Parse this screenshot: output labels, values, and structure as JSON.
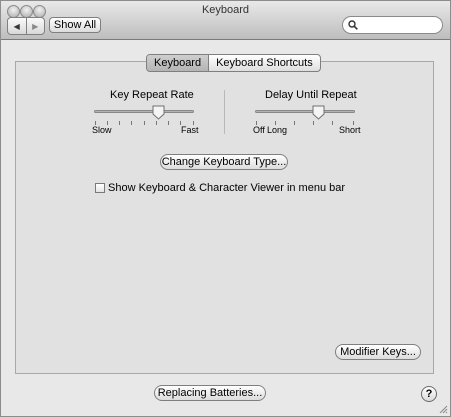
{
  "window": {
    "title": "Keyboard"
  },
  "toolbar": {
    "back_icon": "back-arrow-icon",
    "forward_icon": "forward-arrow-icon",
    "show_all_label": "Show All",
    "search": {
      "value": "",
      "placeholder": ""
    }
  },
  "tabs": [
    {
      "label": "Keyboard",
      "selected": true
    },
    {
      "label": "Keyboard Shortcuts",
      "selected": false
    }
  ],
  "key_repeat": {
    "title": "Key Repeat Rate",
    "min_label": "Slow",
    "max_label": "Fast",
    "value_fraction": 0.65
  },
  "delay_repeat": {
    "title": "Delay Until Repeat",
    "min_label": "Off",
    "mid_label": "Long",
    "max_label": "Short",
    "value_fraction": 0.6
  },
  "change_type_button": "Change Keyboard Type...",
  "show_viewer": {
    "label": "Show Keyboard & Character Viewer in menu bar",
    "checked": false
  },
  "modifier_keys_button": "Modifier Keys...",
  "replacing_batteries_button": "Replacing Batteries...",
  "help_glyph": "?"
}
